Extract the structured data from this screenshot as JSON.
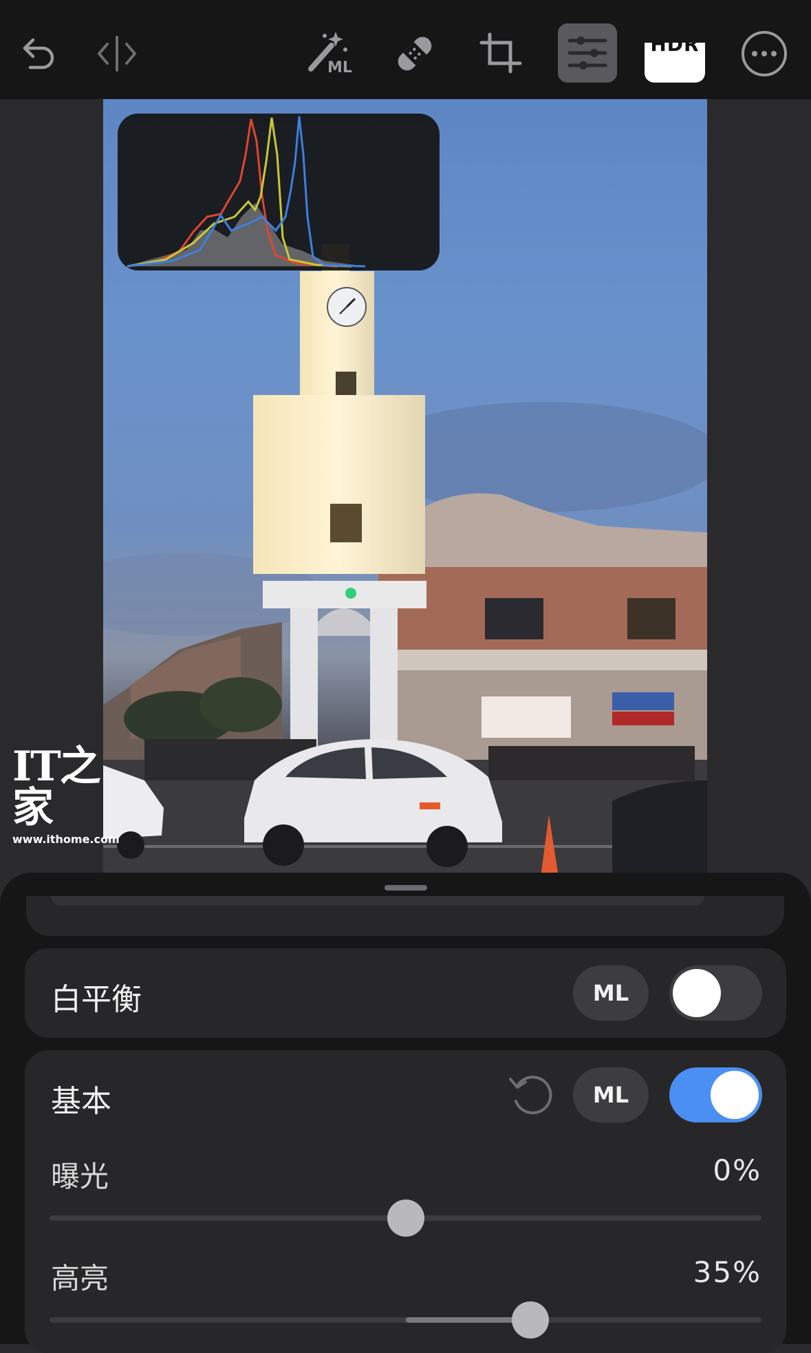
{
  "toolbar": {
    "icons": [
      "undo-icon",
      "compare-icon",
      "ml-magic-wand-icon",
      "bandage-heal-icon",
      "crop-icon",
      "adjust-sliders-icon",
      "hdr-badge",
      "more-icon"
    ],
    "ml_wand_label": "ML",
    "hdr_label": "HDR",
    "active_tool": "adjust-sliders"
  },
  "watermark": {
    "logo": "IT之家",
    "url": "www.ithome.com"
  },
  "histogram": {
    "channels": [
      "red",
      "green",
      "blue",
      "luminance"
    ],
    "colors": {
      "red": "#e0452f",
      "green": "#c9c934",
      "blue": "#3f7fe0",
      "luminance": "#8a8a8a"
    }
  },
  "photo_controls": {
    "icons": [
      "reset-icon",
      "more-horizontal-icon"
    ]
  },
  "panel": {
    "white_balance": {
      "title": "白平衡",
      "ml_label": "ML",
      "enabled": false
    },
    "basic": {
      "title": "基本",
      "ml_label": "ML",
      "enabled": true,
      "sliders": [
        {
          "label": "曝光",
          "value": "0%",
          "level": 0
        },
        {
          "label": "高亮",
          "value": "35%",
          "level": 0.35
        }
      ]
    }
  },
  "colors": {
    "accent": "#4b8ff2",
    "panel_bg": "#161617",
    "card_bg": "#272729"
  }
}
